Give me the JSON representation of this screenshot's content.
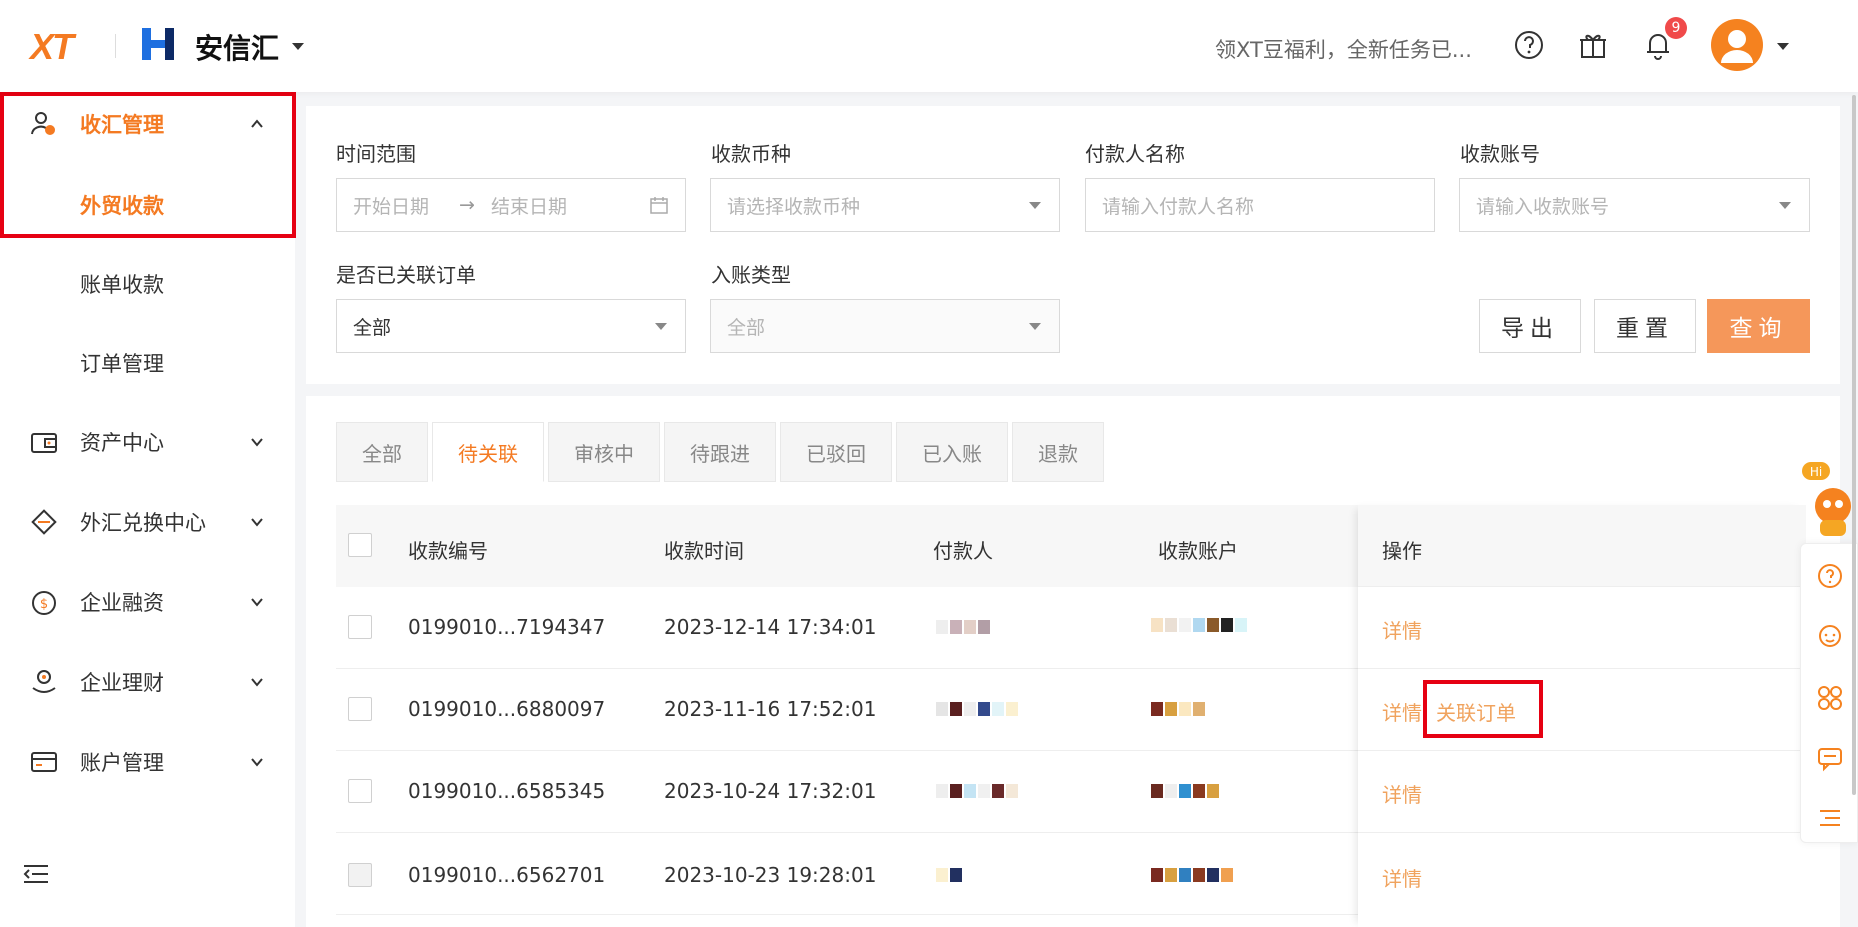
{
  "header": {
    "logo_text": "XT",
    "brand": "安信汇",
    "promo": "领XT豆福利，全新任务已...",
    "notification_count": "9",
    "icons": [
      "help-icon",
      "gift-icon",
      "bell-icon",
      "avatar-icon"
    ]
  },
  "sidebar": {
    "groups": [
      {
        "label": "收汇管理",
        "icon": "user-money-icon",
        "expanded": true
      },
      {
        "label": "资产中心",
        "icon": "wallet-icon"
      },
      {
        "label": "外汇兑换中心",
        "icon": "exchange-icon"
      },
      {
        "label": "企业融资",
        "icon": "finance-icon"
      },
      {
        "label": "企业理财",
        "icon": "wealth-icon"
      },
      {
        "label": "账户管理",
        "icon": "account-card-icon"
      }
    ],
    "sub_items": [
      "外贸收款",
      "账单收款",
      "订单管理"
    ],
    "active_sub": "外贸收款"
  },
  "filters": {
    "time_range_label": "时间范围",
    "start_placeholder": "开始日期",
    "arrow": "→",
    "end_placeholder": "结束日期",
    "currency_label": "收款币种",
    "currency_placeholder": "请选择收款币种",
    "payer_label": "付款人名称",
    "payer_placeholder": "请输入付款人名称",
    "account_label": "收款账号",
    "account_placeholder": "请输入收款账号",
    "linked_label": "是否已关联订单",
    "linked_value": "全部",
    "entry_label": "入账类型",
    "entry_value": "全部"
  },
  "buttons": {
    "export": "导出",
    "reset": "重置",
    "query": "查询"
  },
  "tabs": [
    "全部",
    "待关联",
    "审核中",
    "待跟进",
    "已驳回",
    "已入账",
    "退款"
  ],
  "active_tab": "待关联",
  "table": {
    "columns": [
      "收款编号",
      "收款时间",
      "付款人",
      "收款账户",
      "操作"
    ],
    "rows": [
      {
        "id": "0199010...7194347",
        "time": "2023-12-14 17:34:01",
        "actions": [
          "详情"
        ]
      },
      {
        "id": "0199010...6880097",
        "time": "2023-11-16 17:52:01",
        "actions": [
          "详情",
          "关联订单"
        ]
      },
      {
        "id": "0199010...6585345",
        "time": "2023-10-24 17:32:01",
        "actions": [
          "详情"
        ]
      },
      {
        "id": "0199010...6562701",
        "time": "2023-10-23 19:28:01",
        "actions": [
          "详情"
        ]
      }
    ]
  },
  "float_bar": {
    "hi_label": "Hi",
    "icons": [
      "help-circle-icon",
      "customer-service-icon",
      "apps-icon",
      "chat-icon",
      "list-icon"
    ]
  },
  "colors": {
    "accent": "#f47a22",
    "highlight": "#e60012",
    "link": "#f0a35e",
    "primary_button": "#f5975a"
  }
}
